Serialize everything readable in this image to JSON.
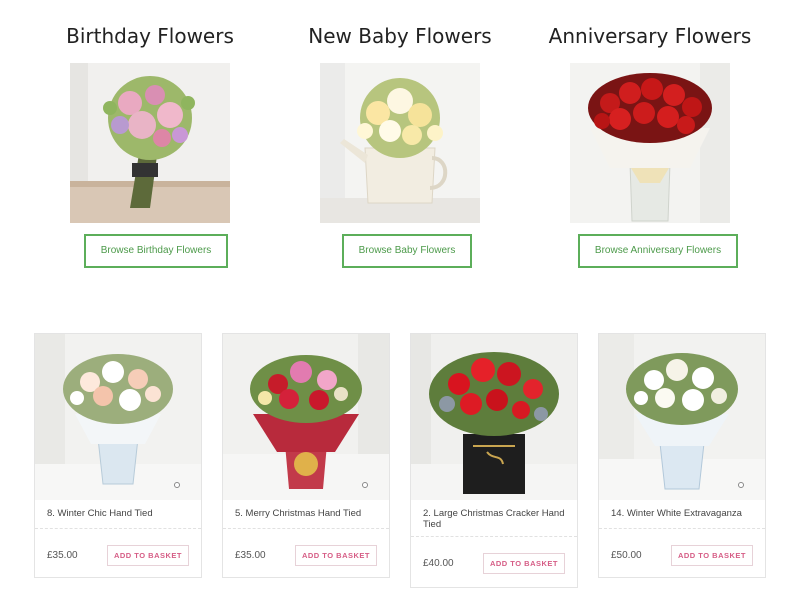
{
  "categories": [
    {
      "title": "Birthday Flowers",
      "button": "Browse Birthday Flowers"
    },
    {
      "title": "New Baby Flowers",
      "button": "Browse Baby Flowers"
    },
    {
      "title": "Anniversary Flowers",
      "button": "Browse Anniversary Flowers"
    }
  ],
  "products": [
    {
      "name": "8. Winter Chic Hand Tied",
      "price": "£35.00",
      "button": "ADD TO BASKET"
    },
    {
      "name": "5. Merry Christmas Hand Tied",
      "price": "£35.00",
      "button": "ADD TO BASKET"
    },
    {
      "name": "2. Large Christmas Cracker Hand Tied",
      "price": "£40.00",
      "button": "ADD TO BASKET"
    },
    {
      "name": "14. Winter White Extravaganza",
      "price": "£50.00",
      "button": "ADD TO BASKET"
    }
  ],
  "colors": {
    "category_button_border": "#5cae5a",
    "category_button_text": "#4c9a4a",
    "basket_button_text": "#d65d86",
    "basket_button_border": "#e7d2d8"
  }
}
